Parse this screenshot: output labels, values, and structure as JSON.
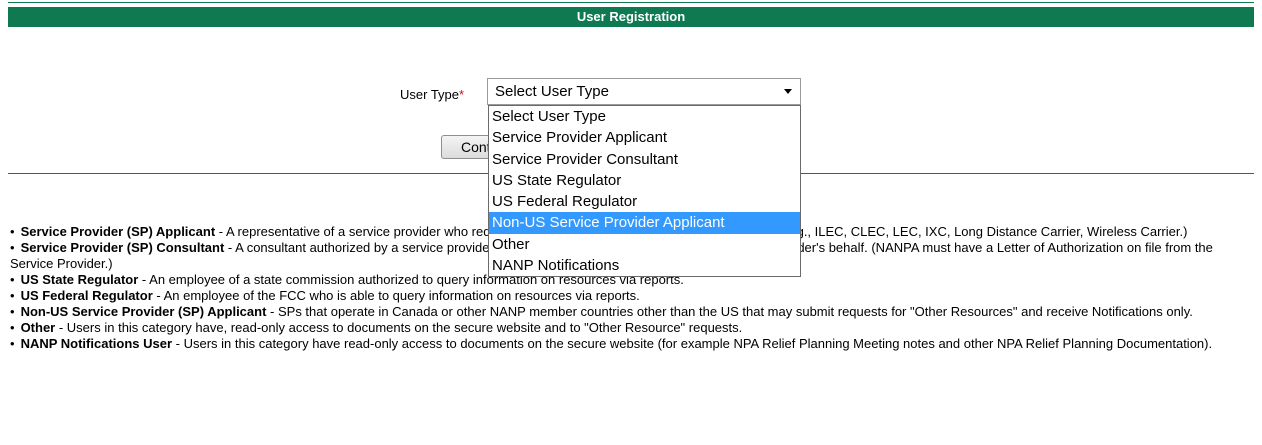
{
  "header": {
    "title": "User Registration"
  },
  "form": {
    "user_type_label": "User Type",
    "required_marker": "*",
    "select_value": "Select User Type",
    "continue_label": "Continue"
  },
  "dropdown": {
    "options": [
      "Select User Type",
      "Service Provider Applicant",
      "Service Provider Consultant",
      "US State Regulator",
      "US Federal Regulator",
      "Non-US Service Provider Applicant",
      "Other",
      "NANP Notifications"
    ],
    "highlighted": "Non-US Service Provider Applicant"
  },
  "descriptions": [
    {
      "bullet": "•",
      "term": "Service Provider (SP) Applicant",
      "text": " - A representative of a service provider who requests assignments of NANP numbering resources (e.g., ILEC, CLEC, LEC, IXC, Long Distance Carrier, Wireless Carrier.)"
    },
    {
      "bullet": "•",
      "term": "Service Provider (SP) Consultant",
      "text": " - A consultant authorized by a service provider to request numbering resources on the service provider's behalf. (NANPA must have a Letter of Authorization on file from the Service Provider.)"
    },
    {
      "bullet": "•",
      "term": "US State Regulator",
      "text": " - An employee of a state commission authorized to query information on resources via reports."
    },
    {
      "bullet": "•",
      "term": "US Federal Regulator",
      "text": " - An employee of the FCC who is able to query information on resources via reports."
    },
    {
      "bullet": "•",
      "term": "Non-US Service Provider (SP) Applicant",
      "text": " - SPs that operate in Canada or other NANP member countries other than the US that may submit requests for \"Other Resources\" and receive Notifications only."
    },
    {
      "bullet": "•",
      "term": "Other",
      "text": " - Users in this category have, read-only access to documents on the secure website and to \"Other Resource\" requests."
    },
    {
      "bullet": "•",
      "term": "NANP Notifications User",
      "text": " - Users in this category have read-only access to documents on the secure website (for example NPA Relief Planning Meeting notes and other NPA Relief Planning Documentation)."
    }
  ],
  "colors": {
    "header_bg": "#0f7a52",
    "highlight": "#3399ff",
    "required": "#e2001a"
  }
}
